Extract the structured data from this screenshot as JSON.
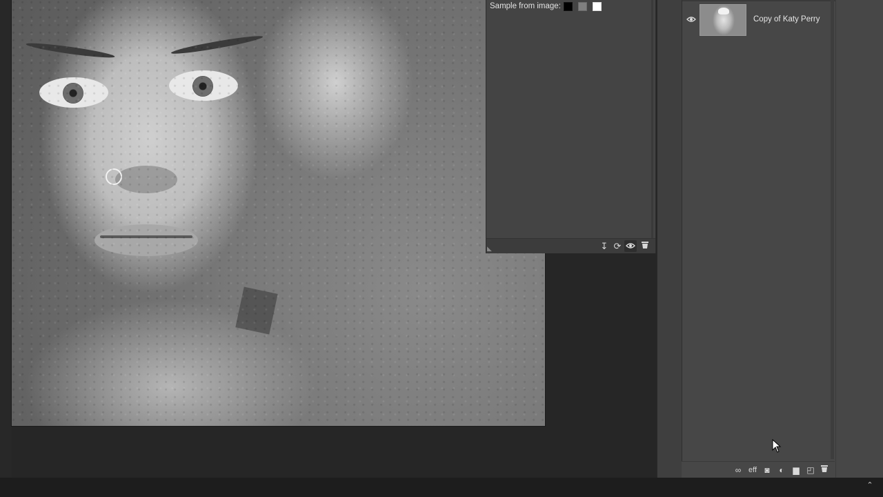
{
  "adjustment_panel": {
    "sample_label": "Sample from image:",
    "swatches": [
      {
        "name": "black",
        "color": "#000000"
      },
      {
        "name": "gray",
        "color": "#808080"
      },
      {
        "name": "white",
        "color": "#ffffff"
      }
    ],
    "footer_icons": [
      "clip-to-layer-icon",
      "reset-icon",
      "visibility-icon",
      "delete-icon"
    ]
  },
  "layers_panel": {
    "layers": [
      {
        "name": "Copy of Katy Perry",
        "visible": true
      }
    ],
    "footer_icons": [
      "link-icon",
      "fx-icon",
      "mask-icon",
      "adjustment-icon",
      "folder-icon",
      "new-layer-icon",
      "delete-layer-icon"
    ],
    "fx_label": "eff"
  },
  "glyphs": {
    "eye": "👁",
    "clip": "↧",
    "reset": "⟳",
    "trash": "🗑",
    "link": "∞",
    "mask": "◙",
    "adjust": "◐",
    "folder": "▆",
    "new": "◰",
    "caret": "⌃",
    "grip": "◣"
  },
  "colors": {
    "panel_bg": "#474747",
    "adj_panel_bg": "#444444",
    "workspace_bg": "#262626"
  }
}
